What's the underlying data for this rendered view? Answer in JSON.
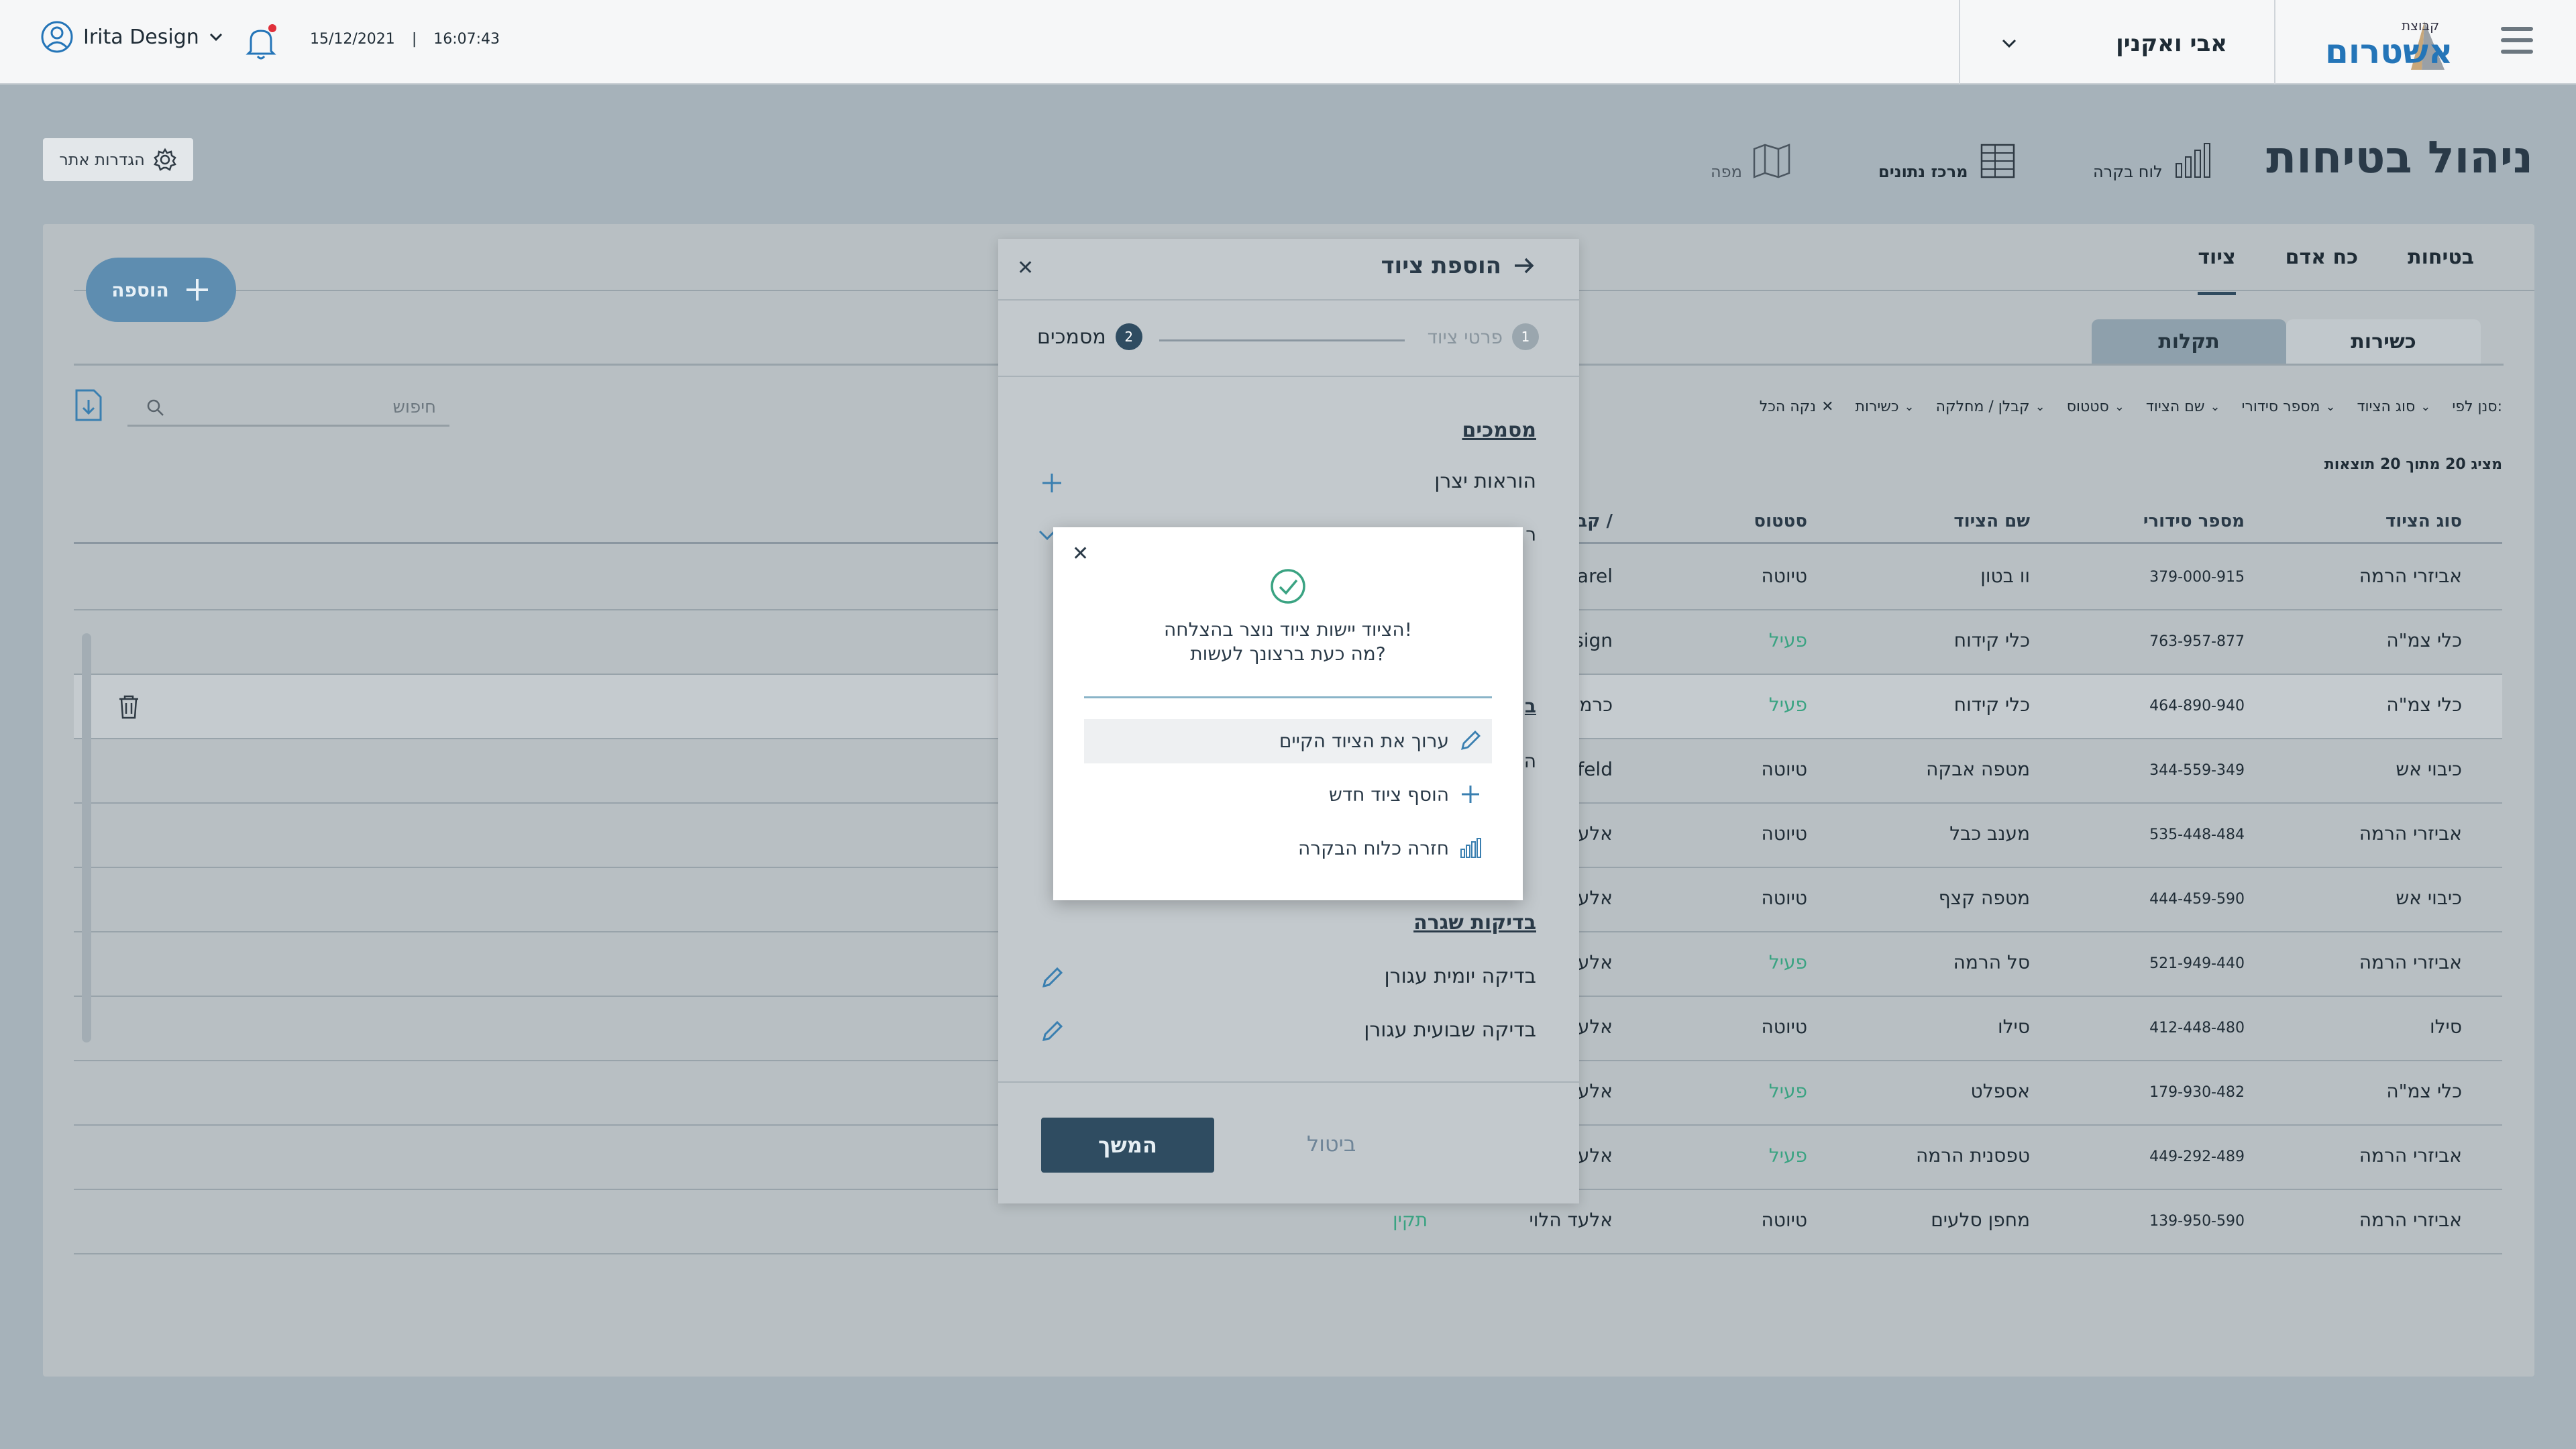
{
  "topbar": {
    "user_name": "Irita Design",
    "date": "15/12/2021",
    "time_sep": "|",
    "time": "16:07:43",
    "company_selected": "אבי ואקנין",
    "logo_small": "קבוצת",
    "logo_big": "אשטרום"
  },
  "header": {
    "settings_label": "הגדרות אתר",
    "title": "ניהול בטיחות",
    "nav": [
      {
        "label": "לוח בקרה",
        "icon": "bar-chart-icon"
      },
      {
        "label": "מרכז נתונים",
        "icon": "table-icon"
      },
      {
        "label": "מפה",
        "icon": "map-icon"
      }
    ]
  },
  "panel": {
    "tabs": [
      "בטיחות",
      "כח אדם",
      "ציוד"
    ],
    "active_tab": "ציוד",
    "add_label": "הוספה",
    "subtabs": [
      "כשירות",
      "תקלות"
    ],
    "search_placeholder": "חיפוש",
    "filter_label": "סנן לפי:",
    "filters": [
      "סוג הציוד",
      "מספר סידורי",
      "שם הציוד",
      "סטטוס",
      "קבלן / מחלקה",
      "כשירות"
    ],
    "clear_all": "נקה הכל",
    "results_text": "מציג 20 מתוך 20 תוצאות",
    "columns": [
      "סוג הציוד",
      "מספר סידורי",
      "שם הציוד",
      "סטטוס",
      "קבלן /"
    ],
    "rows": [
      {
        "type": "אביזרי הרמה",
        "serial": "379-000-915",
        "name": "וו בטון",
        "status": "טיוטה",
        "contractor": "Harel",
        "link": ""
      },
      {
        "type": "כלי צמ\"ה",
        "serial": "763-957-877",
        "name": "כלי קידוח",
        "status": "פעיל",
        "contractor": "Design",
        "link": ""
      },
      {
        "type": "כלי צמ\"ה",
        "serial": "464-890-940",
        "name": "כלי קידוח",
        "status": "פעיל",
        "contractor": "כרמית",
        "link": ""
      },
      {
        "type": "כיבוי אש",
        "serial": "344-559-349",
        "name": "מטפה אבקה",
        "status": "טיוטה",
        "contractor": "shfeld",
        "link": ""
      },
      {
        "type": "אביזרי הרמה",
        "serial": "535-448-484",
        "name": "מענב כבל",
        "status": "טיוטה",
        "contractor": "אלעד",
        "link": ""
      },
      {
        "type": "כיבוי אש",
        "serial": "444-459-590",
        "name": "מטפה קצף",
        "status": "טיוטה",
        "contractor": "אלעד",
        "link": ""
      },
      {
        "type": "אביזרי הרמה",
        "serial": "521-949-440",
        "name": "סל הרמה",
        "status": "פעיל",
        "contractor": "אלעד",
        "link": ""
      },
      {
        "type": "סילו",
        "serial": "412-448-480",
        "name": "סילו",
        "status": "טיוטה",
        "contractor": "אלעד",
        "link": ""
      },
      {
        "type": "כלי צמ\"ה",
        "serial": "179-930-482",
        "name": "אספלט",
        "status": "פעיל",
        "contractor": "אלעד",
        "link": ""
      },
      {
        "type": "אביזרי הרמה",
        "serial": "449-292-489",
        "name": "טפסנית הרמה",
        "status": "פעיל",
        "contractor": "אלעד",
        "link": ""
      },
      {
        "type": "אביזרי הרמה",
        "serial": "139-950-590",
        "name": "מחפן סלעים",
        "status": "טיוטה",
        "contractor": "אלעד הלוי",
        "link": "תקין"
      }
    ]
  },
  "sheet": {
    "title": "הוספת ציוד",
    "step1_num": "1",
    "step1_label": "פרטי ציוד",
    "step2_num": "2",
    "step2_label": "מסמכים",
    "docs_title": "מסמכים",
    "doc_manufacturer": "הוראות יצרן",
    "frag_r": "ר",
    "frag_b": "ב",
    "frag_h": "ה",
    "checks_title": "בדיקות שגרה",
    "check_daily": "בדיקה יומית עגורן",
    "check_weekly": "בדיקה שבועית עגורן",
    "cancel_label": "ביטול",
    "continue_label": "המשך"
  },
  "dialog": {
    "msg_line1": "הציוד יישות ציוד נוצר בהצלחה!",
    "msg_line2": "מה כעת ברצונך לעשות?",
    "opt_edit": "ערוך את הציוד הקיים",
    "opt_add": "הוסף ציוד חדש",
    "opt_back": "חזרה כלוח הבקרה"
  },
  "colors": {
    "brand_blue": "#2475b8",
    "active_green": "#3aa382",
    "primary_button": "#2f4c61",
    "overlay_bg": "#a6b2ba"
  }
}
